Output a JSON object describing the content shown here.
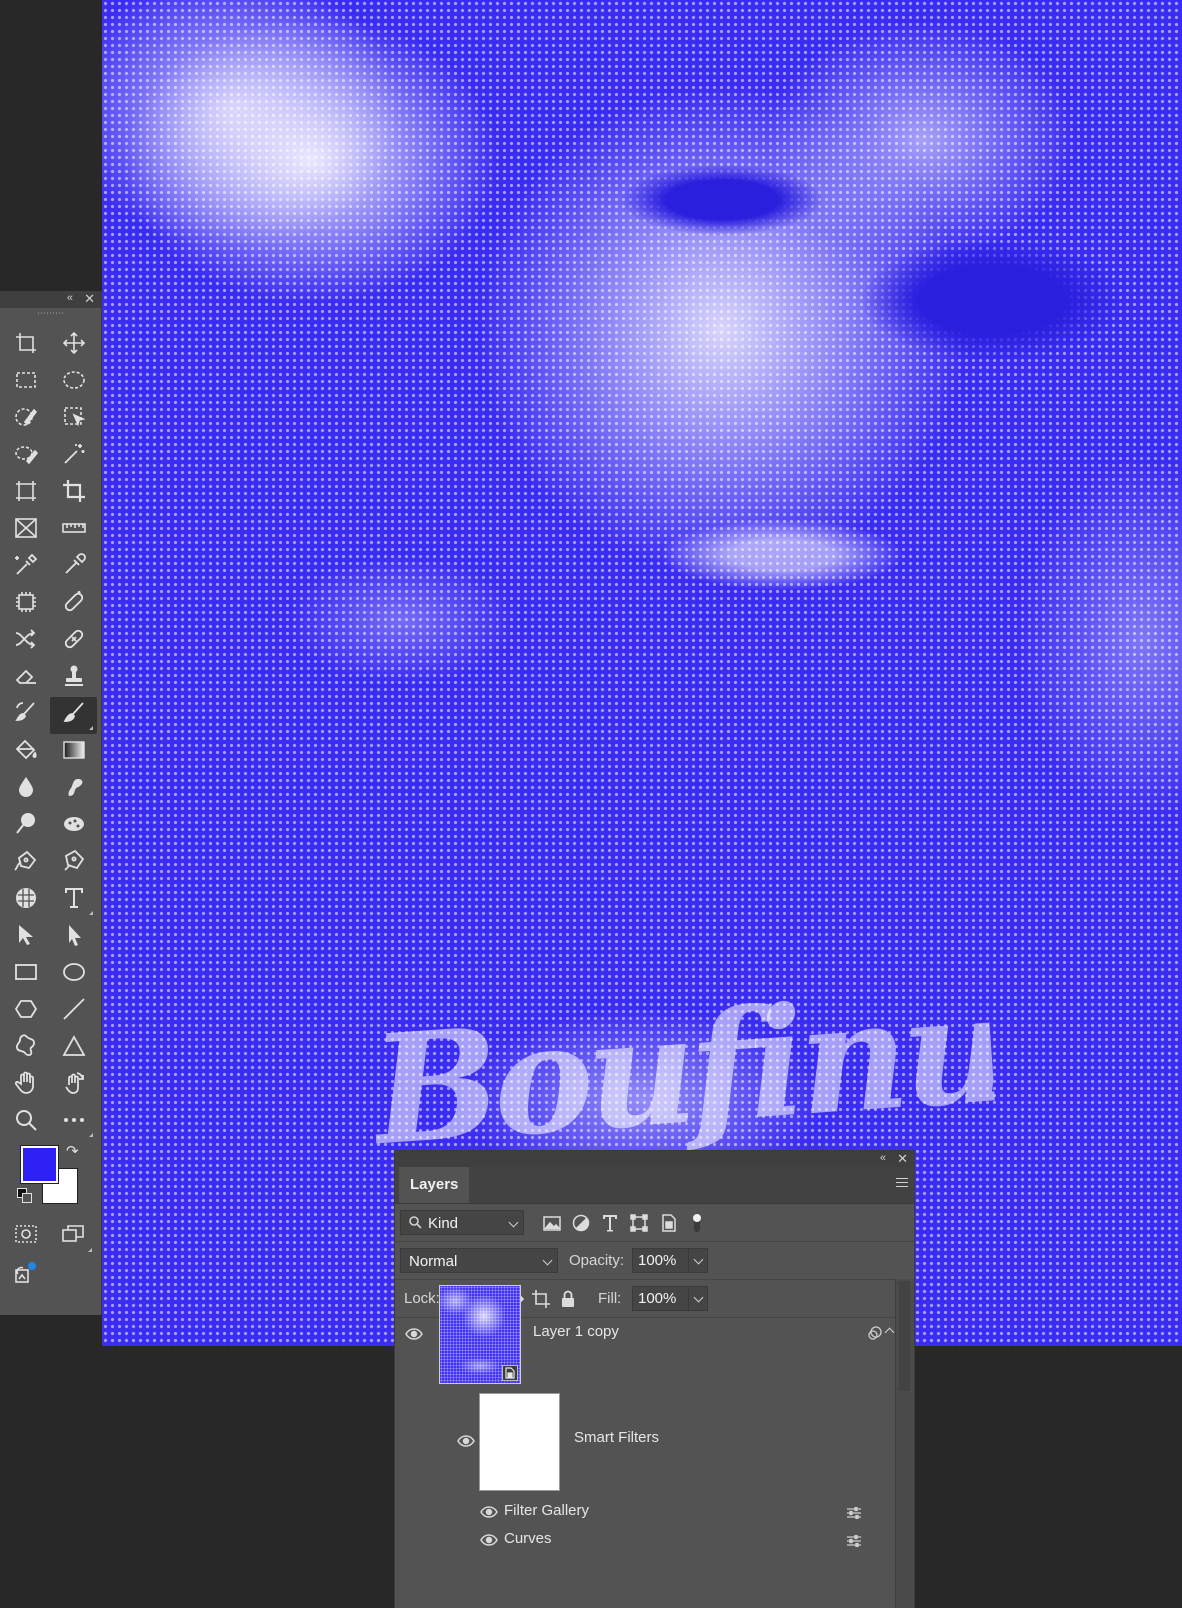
{
  "app": {
    "panel_collapse": "«",
    "panel_close": "✕"
  },
  "document": {
    "lettering": "Boufinu",
    "accent_color": "#3a2cf2"
  },
  "toolbar": {
    "tools": [
      {
        "id": "artboard",
        "icon": "artboard-icon",
        "active": false,
        "corner": false
      },
      {
        "id": "move",
        "icon": "move-icon",
        "active": false,
        "corner": false
      },
      {
        "id": "rect-marquee",
        "icon": "rectangular-marquee-icon",
        "active": false,
        "corner": false
      },
      {
        "id": "ellipse-marquee",
        "icon": "elliptical-marquee-icon",
        "active": false,
        "corner": false
      },
      {
        "id": "quick-select",
        "icon": "quick-selection-icon",
        "active": false,
        "corner": false
      },
      {
        "id": "object-select",
        "icon": "object-selection-icon",
        "active": false,
        "corner": false
      },
      {
        "id": "lasso",
        "icon": "lasso-icon",
        "active": false,
        "corner": false
      },
      {
        "id": "magic-wand",
        "icon": "magic-wand-icon",
        "active": false,
        "corner": false
      },
      {
        "id": "perspective-crop",
        "icon": "perspective-crop-icon",
        "active": false,
        "corner": false
      },
      {
        "id": "crop",
        "icon": "crop-icon",
        "active": false,
        "corner": false
      },
      {
        "id": "frame",
        "icon": "frame-icon",
        "active": false,
        "corner": false
      },
      {
        "id": "ruler",
        "icon": "ruler-icon",
        "active": false,
        "corner": false
      },
      {
        "id": "color-sampler",
        "icon": "color-sampler-icon",
        "active": false,
        "corner": false
      },
      {
        "id": "eyedropper",
        "icon": "eyedropper-icon",
        "active": false,
        "corner": false
      },
      {
        "id": "count",
        "icon": "chip-icon",
        "active": false,
        "corner": false
      },
      {
        "id": "spot-healing",
        "icon": "spot-healing-icon",
        "active": false,
        "corner": false
      },
      {
        "id": "content-aware-move",
        "icon": "content-aware-move-icon",
        "active": false,
        "corner": false
      },
      {
        "id": "healing",
        "icon": "healing-brush-icon",
        "active": false,
        "corner": false
      },
      {
        "id": "eraser",
        "icon": "eraser-icon",
        "active": false,
        "corner": false
      },
      {
        "id": "stamp",
        "icon": "clone-stamp-icon",
        "active": false,
        "corner": false
      },
      {
        "id": "history-brush",
        "icon": "history-brush-icon",
        "active": false,
        "corner": false
      },
      {
        "id": "brush",
        "icon": "brush-icon",
        "active": true,
        "corner": true
      },
      {
        "id": "paint-bucket",
        "icon": "paint-bucket-icon",
        "active": false,
        "corner": false
      },
      {
        "id": "gradient",
        "icon": "gradient-icon",
        "active": false,
        "corner": false
      },
      {
        "id": "blur",
        "icon": "blur-icon",
        "active": false,
        "corner": false
      },
      {
        "id": "smudge",
        "icon": "smudge-icon",
        "active": false,
        "corner": false
      },
      {
        "id": "dodge",
        "icon": "dodge-icon",
        "active": false,
        "corner": false
      },
      {
        "id": "sponge",
        "icon": "sponge-icon",
        "active": false,
        "corner": false
      },
      {
        "id": "freeform-pen",
        "icon": "freeform-pen-icon",
        "active": false,
        "corner": false
      },
      {
        "id": "pen",
        "icon": "pen-icon",
        "active": false,
        "corner": false
      },
      {
        "id": "puppet-warp",
        "icon": "mesh-icon",
        "active": false,
        "corner": false
      },
      {
        "id": "type",
        "icon": "type-icon",
        "active": false,
        "corner": true
      },
      {
        "id": "path-select",
        "icon": "path-selection-icon",
        "active": false,
        "corner": false
      },
      {
        "id": "direct-select",
        "icon": "direct-selection-icon",
        "active": false,
        "corner": false
      },
      {
        "id": "rectangle",
        "icon": "rectangle-icon",
        "active": false,
        "corner": false
      },
      {
        "id": "ellipse",
        "icon": "ellipse-icon",
        "active": false,
        "corner": false
      },
      {
        "id": "polygon",
        "icon": "polygon-icon",
        "active": false,
        "corner": false
      },
      {
        "id": "line",
        "icon": "line-icon",
        "active": false,
        "corner": false
      },
      {
        "id": "custom-shape",
        "icon": "custom-shape-icon",
        "active": false,
        "corner": false
      },
      {
        "id": "triangle",
        "icon": "triangle-icon",
        "active": false,
        "corner": false
      },
      {
        "id": "hand",
        "icon": "hand-icon",
        "active": false,
        "corner": false
      },
      {
        "id": "rotate-view",
        "icon": "rotate-view-icon",
        "active": false,
        "corner": false
      },
      {
        "id": "zoom",
        "icon": "zoom-icon",
        "active": false,
        "corner": false
      },
      {
        "id": "more",
        "icon": "more-icon",
        "active": false,
        "corner": true
      }
    ],
    "foreground_color": "#2d20f5",
    "background_color": "#ffffff",
    "swap_glyph": "↷"
  },
  "layers_panel": {
    "tab_label": "Layers",
    "filter_kind": "Kind",
    "blend_mode": "Normal",
    "opacity_label": "Opacity:",
    "opacity_value": "100%",
    "lock_label": "Lock:",
    "fill_label": "Fill:",
    "fill_value": "100%",
    "layers": [
      {
        "name": "Layer 1 copy"
      },
      {
        "name": "Smart Filters"
      },
      {
        "name": "Filter Gallery"
      },
      {
        "name": "Curves"
      }
    ]
  }
}
